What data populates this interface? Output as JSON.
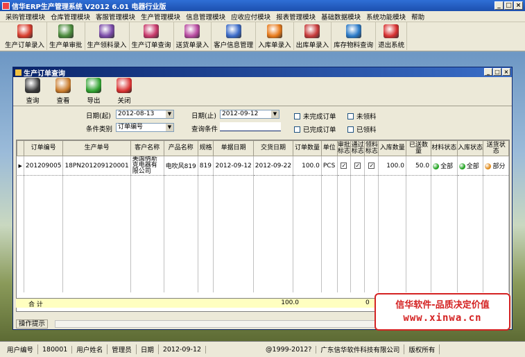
{
  "app": {
    "title": "信华ERP生产管理系统  V2012 6.01 电器行业版"
  },
  "window_buttons": [
    "_",
    "□",
    "×"
  ],
  "menu": [
    "采购管理模块",
    "仓库管理模块",
    "客服管理模块",
    "生产管理模块",
    "信息管理模块",
    "应收应付模块",
    "报表管理模块",
    "基础数据模块",
    "系统功能模块",
    "帮助"
  ],
  "toolbar": [
    {
      "label": "生产订单录入",
      "icon": "pdf-pencil-icon",
      "color": "#d83c2c"
    },
    {
      "label": "生产单审批",
      "icon": "approve-icon",
      "color": "#4a8a3a"
    },
    {
      "label": "生产领料录入",
      "icon": "pick-material-icon",
      "color": "#7a4aa8"
    },
    {
      "label": "生产订单查询",
      "icon": "order-query-icon",
      "color": "#c8386a"
    },
    {
      "label": "送货单录入",
      "icon": "delivery-icon",
      "color": "#b84aa0"
    },
    {
      "label": "客户信息管理",
      "icon": "customer-icon",
      "color": "#3a6ac8"
    },
    {
      "label": "入库单录入",
      "icon": "stock-in-icon",
      "color": "#e87a1a"
    },
    {
      "label": "出库单录入",
      "icon": "stock-out-icon",
      "color": "#c83a3a"
    },
    {
      "label": "库存物料查询",
      "icon": "inventory-icon",
      "color": "#2a7ac8"
    },
    {
      "label": "退出系统",
      "icon": "power-icon",
      "color": "#d83030"
    }
  ],
  "child": {
    "title": "生产订单查询",
    "buttons": [
      {
        "label": "查询",
        "icon": "magnifier-icon",
        "color": "#3a3a3a"
      },
      {
        "label": "查看",
        "icon": "view-icon",
        "color": "#c87a2a"
      },
      {
        "label": "导出",
        "icon": "export-arrow-icon",
        "color": "#2ea02e"
      },
      {
        "label": "关闭",
        "icon": "close-power-icon",
        "color": "#d83030"
      }
    ],
    "filters": {
      "date_start_label": "日期(起)",
      "date_start": "2012-08-13",
      "date_end_label": "日期(止)",
      "date_end": "2012-09-12",
      "condition_type_label": "条件类别",
      "condition_type": "订单编号",
      "query_condition_label": "查询条件",
      "query_condition": "",
      "chk_unfinished": "未完成订单",
      "chk_unpicked": "未领料",
      "chk_finished": "已完成订单",
      "chk_picked": "已领料"
    },
    "columns": [
      "订单编号",
      "生产单号",
      "客户名称",
      "产品名称",
      "规格",
      "单据日期",
      "交货日期",
      "订单数量",
      "单位",
      "审批标志",
      "通过标志",
      "领料标志",
      "入库数量",
      "已送数量",
      "材料状态",
      "入库状态",
      "送货状态"
    ],
    "rows": [
      {
        "order_no": "201209005",
        "prod_no": "18PN201209120001",
        "customer": "美国纳斯克电器有限公司",
        "product": "电吹风819",
        "spec": "819",
        "doc_date": "2012-09-12",
        "delivery_date": "2012-09-22",
        "qty": "100.0",
        "unit": "PCS",
        "approved": "✓",
        "passed": "✓",
        "picked": "✓",
        "in_qty": "100.0",
        "sent_qty": "50.0",
        "material_status": "全部",
        "in_status": "全部",
        "delivery_status": "部分"
      }
    ],
    "status_colors": {
      "full": "#1fa31f",
      "partial": "#e08a1a"
    },
    "total_label": "合 计",
    "total_qty": "100.0",
    "total_prefix": "0",
    "hint_label": "操作提示"
  },
  "watermark": {
    "line1": "信华软件-品质决定价值",
    "line2": "www.xinwa.cn"
  },
  "status": {
    "user_no_label": "用户编号",
    "user_no": "180001",
    "user_name_label": "用户姓名",
    "user_name": "管理员",
    "date_label": "日期",
    "date": "2012-09-12",
    "copyright": "@1999-2012?",
    "company": "广东信华软件科技有限公司",
    "rights": "版权所有"
  }
}
